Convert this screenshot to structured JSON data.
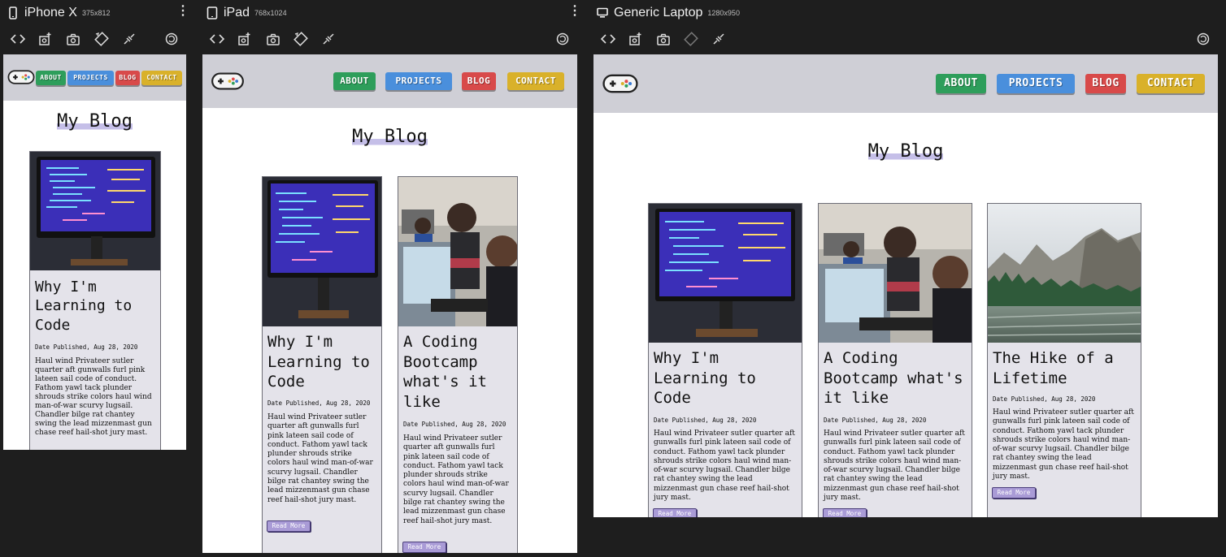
{
  "devices": [
    {
      "name": "iPhone X",
      "size": "375x812"
    },
    {
      "name": "iPad",
      "size": "768x1024"
    },
    {
      "name": "Generic Laptop",
      "size": "1280x950"
    }
  ],
  "nav": {
    "about": "ABOUT",
    "projects": "PROJECTS",
    "blog": "BLOG",
    "contact": "CONTACT"
  },
  "colors": {
    "about": "#2e9e5b",
    "projects": "#4a8fdc",
    "blog": "#d84a4a",
    "contact": "#d9b12a",
    "header_bg": "#cfcfd6",
    "card_bg": "#e4e3ea",
    "highlight": "#c5bfe8"
  },
  "page_title": "My Blog",
  "posts": [
    {
      "title": "Why I'm Learning to Code",
      "date": "Date Published, Aug 28, 2020",
      "excerpt": "Haul wind Privateer sutler quarter aft gunwalls furl pink lateen sail code of conduct. Fathom yawl tack plunder shrouds strike colors haul wind man-of-war scurvy lugsail. Chandler bilge rat chantey swing the lead mizzenmast gun chase reef hail-shot jury mast.",
      "read_more": "Read More",
      "image": "monitor-code"
    },
    {
      "title": "A Coding Bootcamp what's it like",
      "date": "Date Published, Aug 28, 2020",
      "excerpt": "Haul wind Privateer sutler quarter aft gunwalls furl pink lateen sail code of conduct. Fathom yawl tack plunder shrouds strike colors haul wind man-of-war scurvy lugsail. Chandler bilge rat chantey swing the lead mizzenmast gun chase reef hail-shot jury mast.",
      "read_more": "Read More",
      "image": "people-coding"
    },
    {
      "title": "The Hike of a Lifetime",
      "date": "Date Published, Aug 28, 2020",
      "excerpt": "Haul wind Privateer sutler quarter aft gunwalls furl pink lateen sail code of conduct. Fathom yawl tack plunder shrouds strike colors haul wind man-of-war scurvy lugsail. Chandler bilge rat chantey swing the lead mizzenmast gun chase reef hail-shot jury mast.",
      "read_more": "Read More",
      "image": "mountain-river"
    }
  ]
}
